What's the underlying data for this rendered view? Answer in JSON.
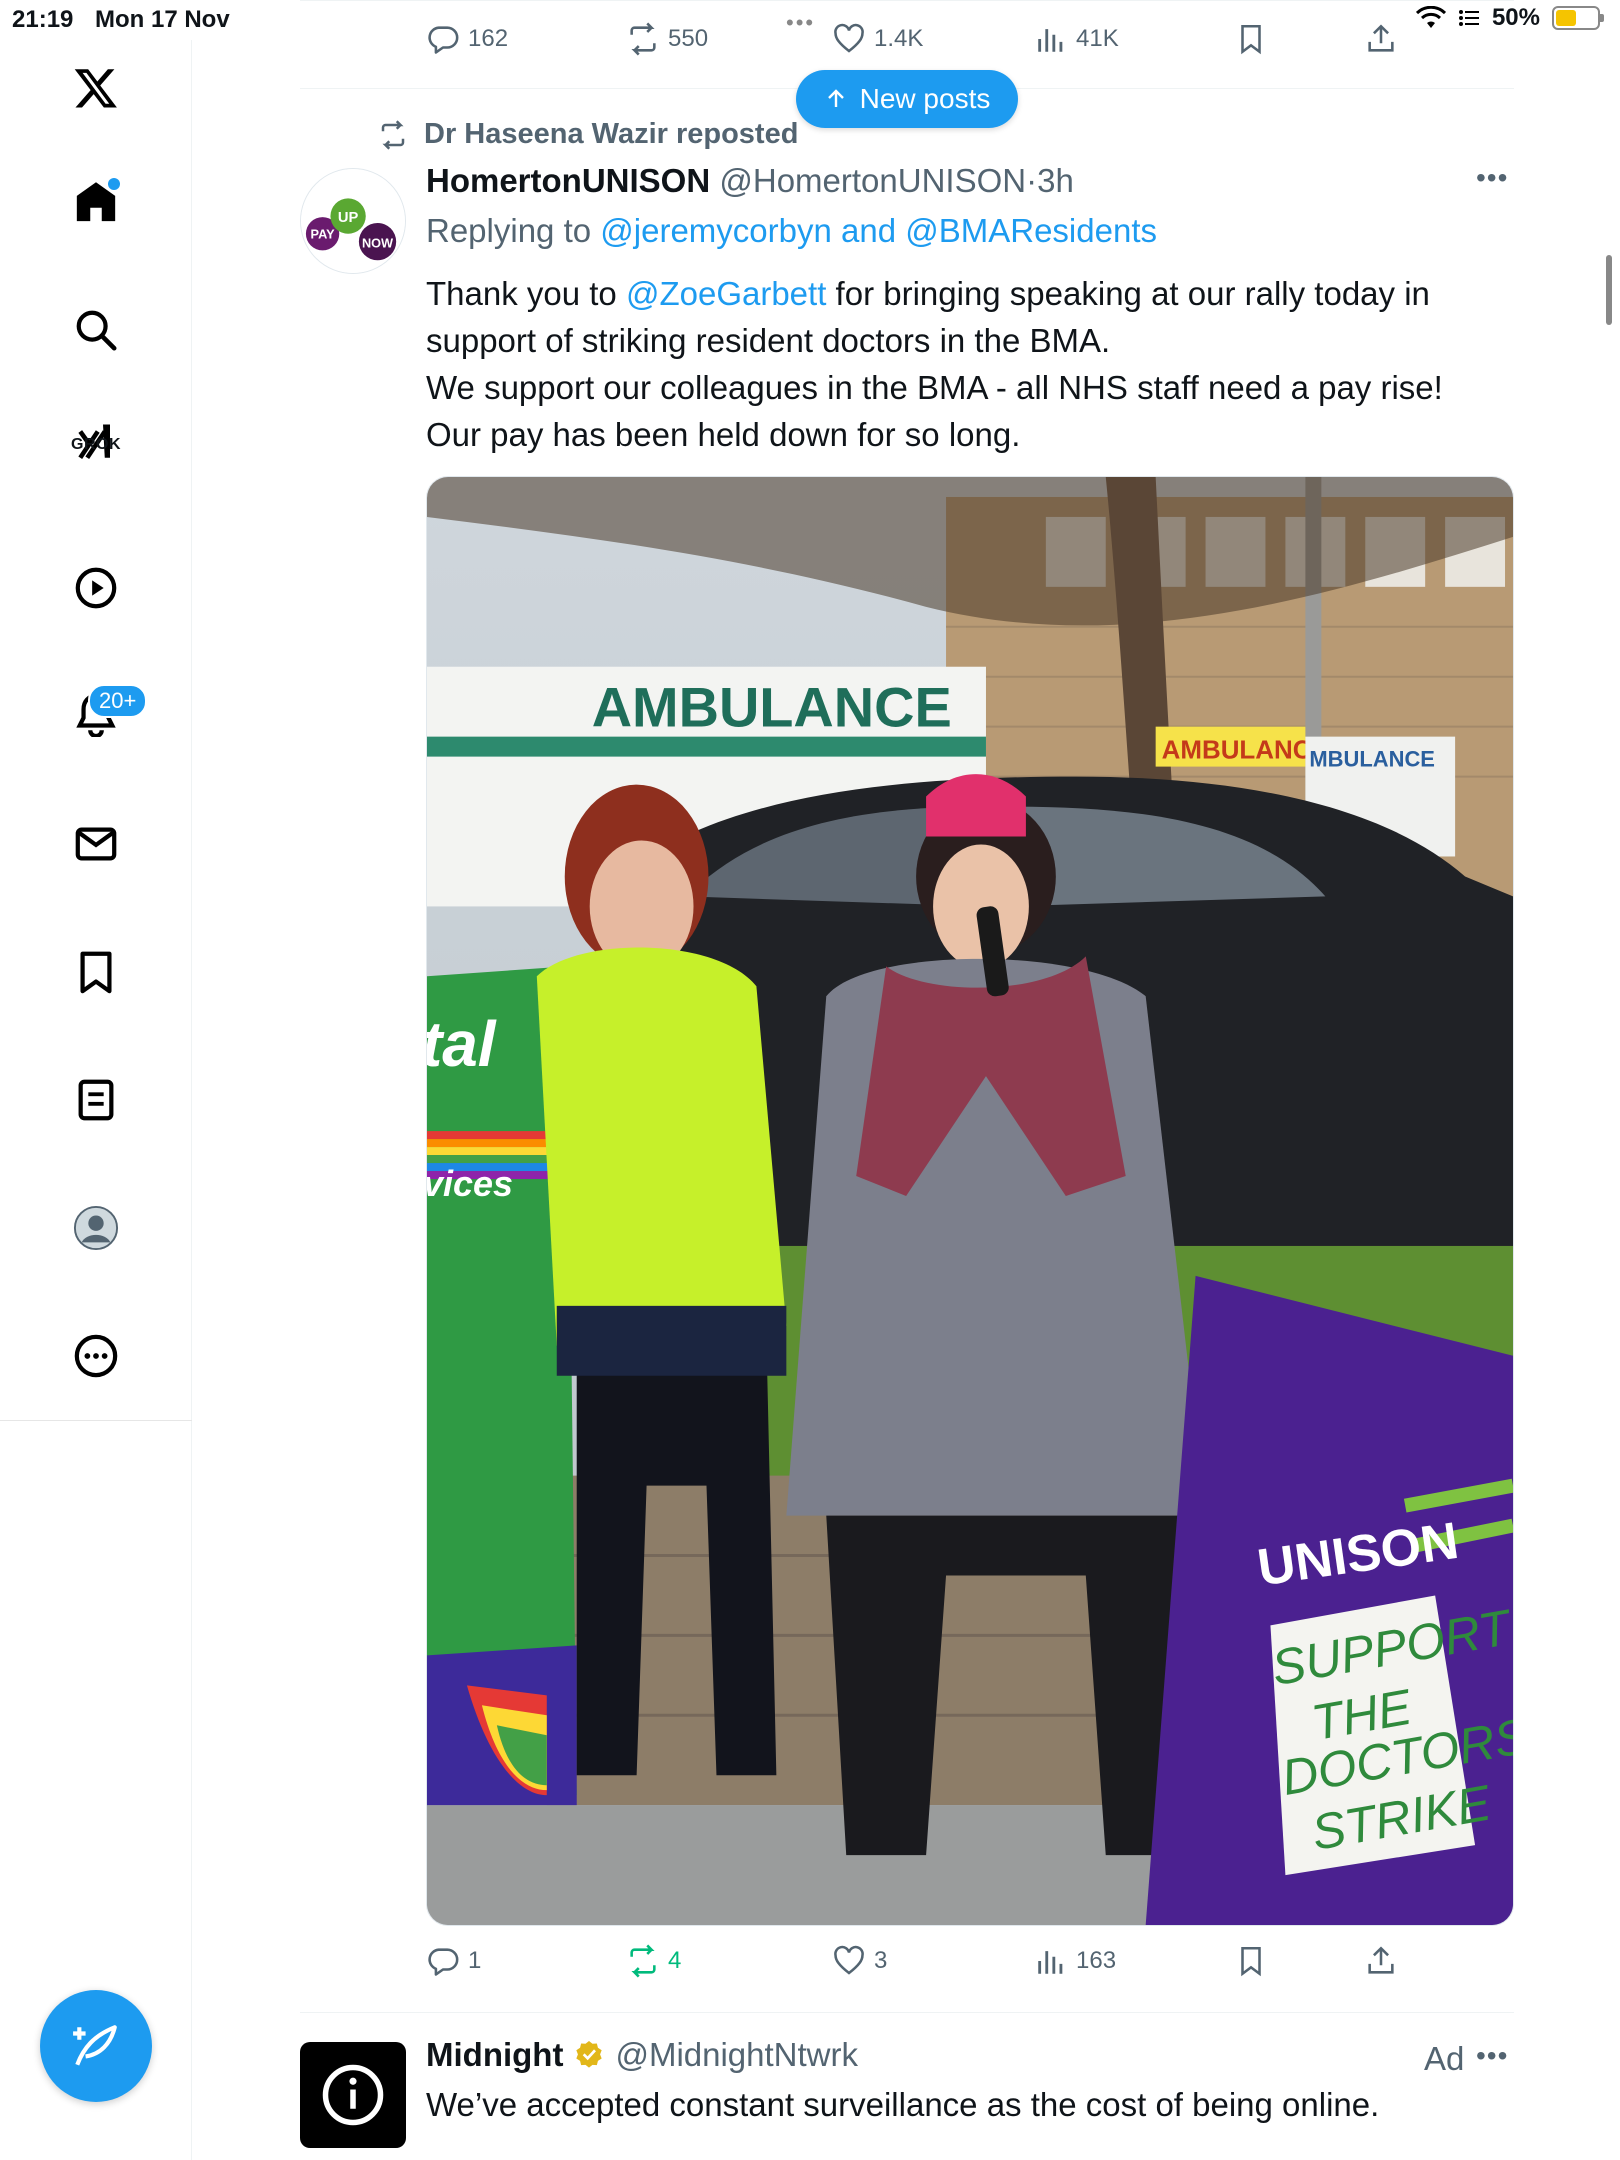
{
  "status_bar": {
    "time": "21:19",
    "date": "Mon 17 Nov",
    "battery": "50%",
    "battery_level": 0.5
  },
  "sidebar": {
    "items": [
      {
        "name": "home-icon"
      },
      {
        "name": "search-icon"
      },
      {
        "name": "grok-icon",
        "label": "GROK"
      },
      {
        "name": "video-icon"
      },
      {
        "name": "notifications-icon",
        "badge": "20+"
      },
      {
        "name": "messages-icon"
      },
      {
        "name": "bookmarks-icon"
      },
      {
        "name": "lists-icon"
      },
      {
        "name": "profile-icon"
      },
      {
        "name": "more-icon"
      }
    ]
  },
  "prev_tweet_actions": {
    "replies": "162",
    "reposts": "550",
    "likes": "1.4K",
    "views": "41K"
  },
  "new_posts_label": "New posts",
  "tweet": {
    "reposted_by": "Dr Haseena Wazir reposted",
    "author_name": "HomertonUNISON",
    "author_handle": "@HomertonUNISON",
    "separator": "·",
    "time": "3h",
    "replying_prefix": "Replying to",
    "replying_to": "@jeremycorbyn and @BMAResidents",
    "text_prefix": "Thank you to",
    "mention": "@ZoeGarbett",
    "text_line1_rest": "for bringing speaking at our rally today in",
    "text_line2": "support of striking resident doctors in the BMA.",
    "text_line3": "We support our colleagues in the BMA - all NHS staff need a pay rise!",
    "text_line4": "Our pay has been held down for so long.",
    "image_text": {
      "ambulance": "AMBULANCE",
      "ambulance_small": "AMBULANCE",
      "ambulance_small2": "MBULANCE",
      "banner_text": "tal",
      "banner_text2": "vices",
      "unison": "UNISON",
      "sign_line1": "SUPPORT",
      "sign_line2": "THE",
      "sign_line3": "DOCTORS",
      "sign_line4": "STRIKE",
      "avatar_pay": "PAY",
      "avatar_up": "UP",
      "avatar_now": "NOW"
    },
    "actions": {
      "replies": "1",
      "reposts": "4",
      "likes": "3",
      "views": "163"
    }
  },
  "ad": {
    "name": "Midnight",
    "handle": "@MidnightNtwrk",
    "label": "Ad",
    "text": "We’ve accepted constant surveillance as the cost of being online."
  },
  "colors": {
    "accent": "#1d9bf0",
    "repost_green": "#00ba7c",
    "muted": "#536471"
  }
}
